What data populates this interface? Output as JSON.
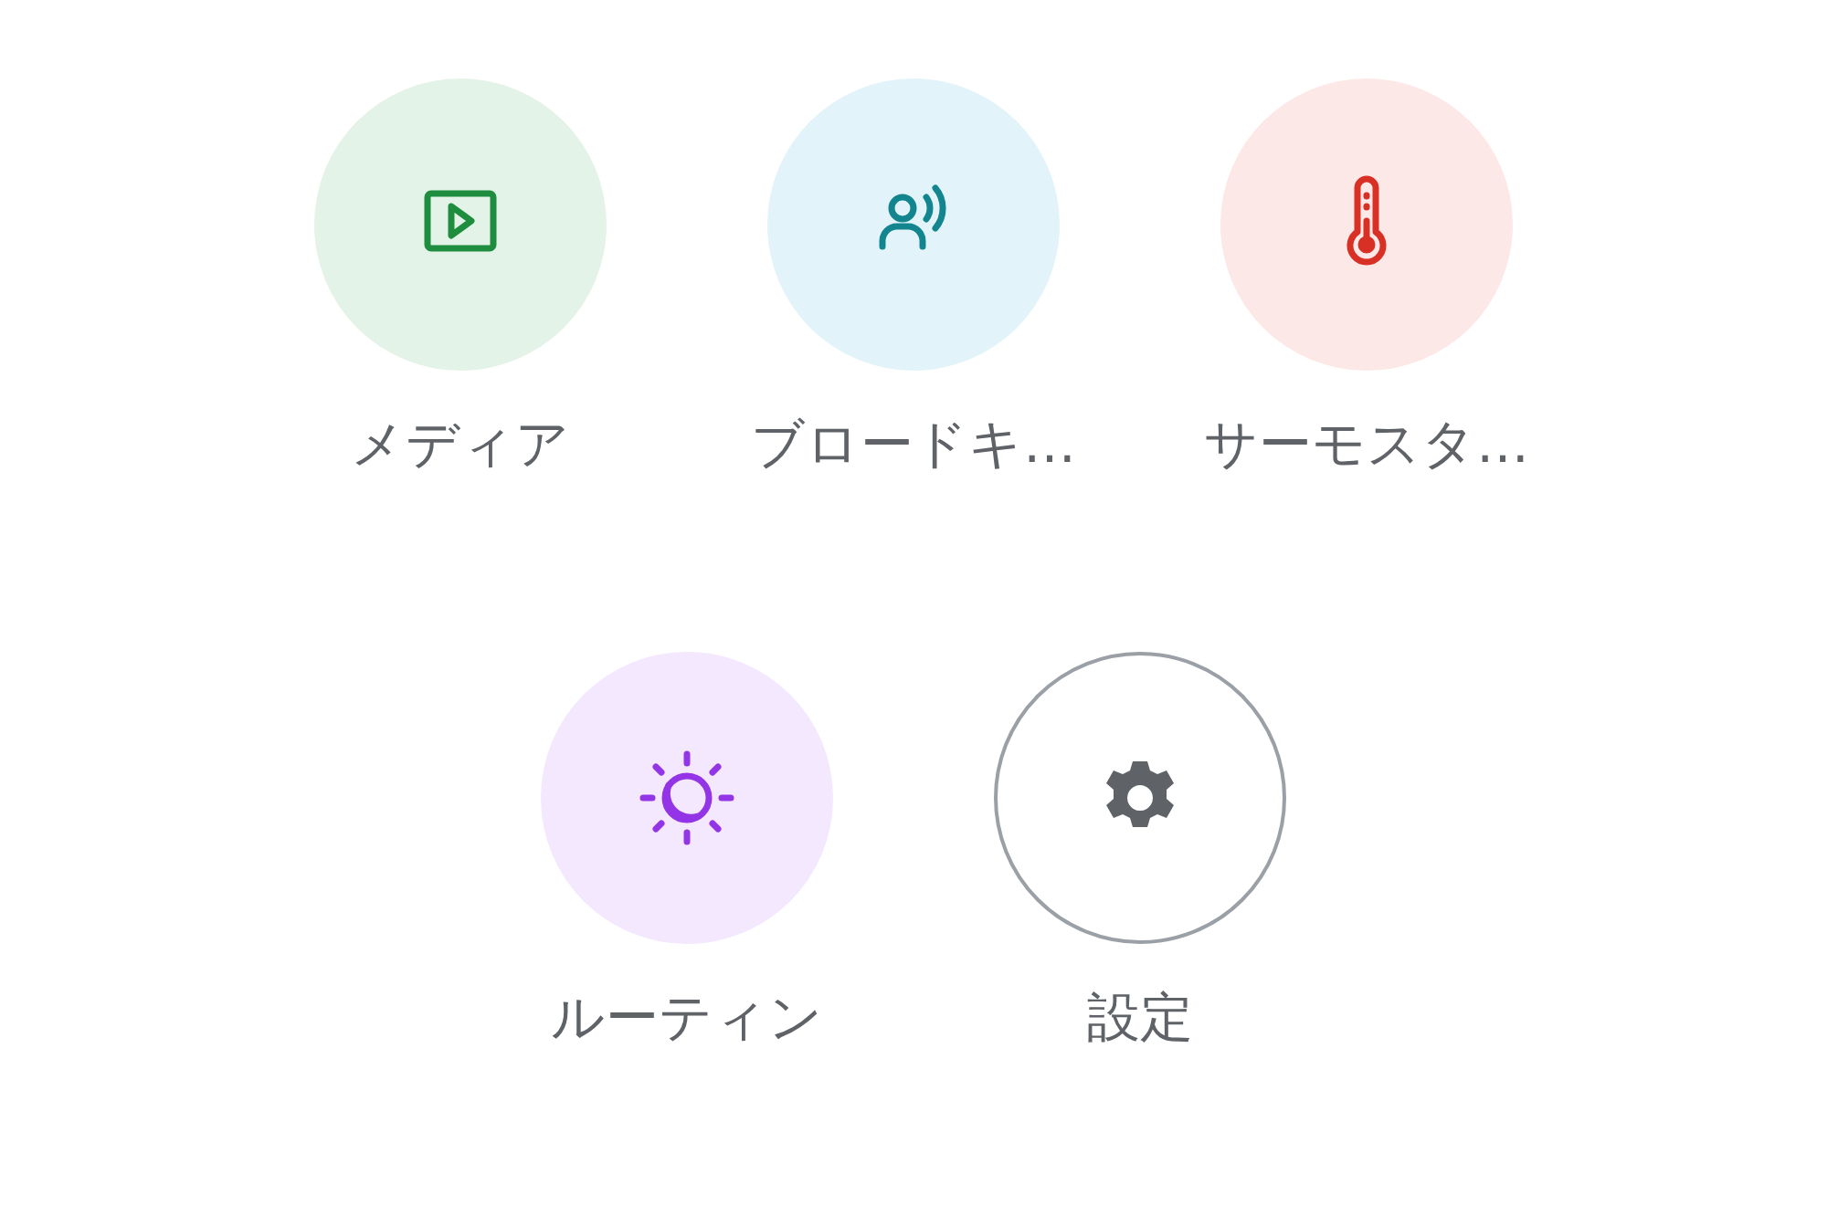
{
  "rows": [
    {
      "items": [
        {
          "kind": "media",
          "label": "メディア",
          "color": "#1e8e3e"
        },
        {
          "kind": "broadcast",
          "label": "ブロードキ…",
          "color": "#12858f"
        },
        {
          "kind": "thermostat",
          "label": "サーモスタ…",
          "color": "#d93025"
        }
      ]
    },
    {
      "items": [
        {
          "kind": "routine",
          "label": "ルーティン",
          "color": "#9334e6"
        },
        {
          "kind": "settings",
          "label": "設定",
          "color": "#5f6368"
        }
      ]
    }
  ]
}
